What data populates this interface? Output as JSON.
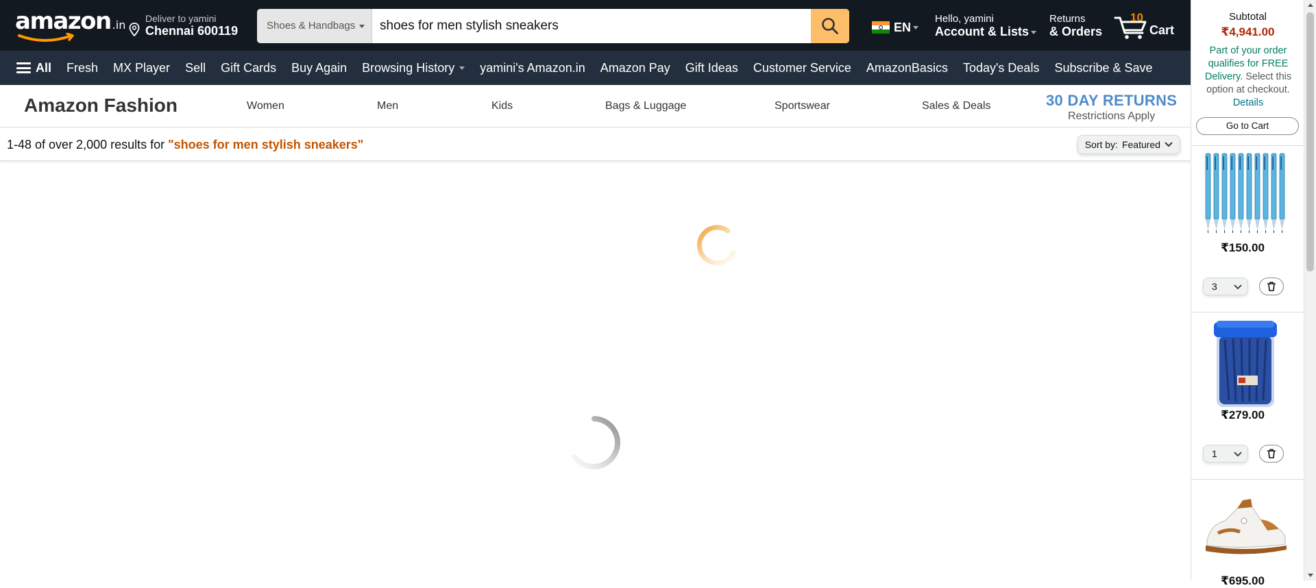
{
  "header": {
    "logo_text": "amazon",
    "logo_tld": ".in",
    "deliver_line1": "Deliver to yamini",
    "deliver_line2": "Chennai 600119",
    "search_category": "Shoes & Handbags",
    "search_value": "shoes for men stylish sneakers",
    "language": "EN",
    "account_line1": "Hello, yamini",
    "account_line2": "Account & Lists",
    "returns_line1": "Returns",
    "returns_line2": "& Orders",
    "cart_count": "10",
    "cart_label": "Cart"
  },
  "nav": {
    "all_label": "All",
    "items": [
      "Fresh",
      "MX Player",
      "Sell",
      "Gift Cards",
      "Buy Again",
      "Browsing History",
      "yamini's Amazon.in",
      "Amazon Pay",
      "Gift Ideas",
      "Customer Service",
      "AmazonBasics",
      "Today's Deals",
      "Subscribe & Save"
    ]
  },
  "fashion": {
    "brand": "Amazon Fashion",
    "categories": [
      "Women",
      "Men",
      "Kids",
      "Bags & Luggage",
      "Sportswear",
      "Sales & Deals"
    ],
    "returns_big": "30 DAY RETURNS",
    "returns_small": "Restrictions Apply"
  },
  "results": {
    "count_text": "1-48 of over 2,000 results for ",
    "query": "\"shoes for men stylish sneakers\"",
    "sort_label": "Sort by:",
    "sort_value": "Featured"
  },
  "cart_panel": {
    "subtotal_label": "Subtotal",
    "subtotal_value": "₹4,941.00",
    "free_delivery": "Part of your order qualifies for FREE Delivery.",
    "free_note": "Select this option at checkout.",
    "details_link": "Details",
    "go_to_cart": "Go to Cart",
    "items": [
      {
        "price": "₹150.00",
        "qty": "3",
        "image": "pens-pack"
      },
      {
        "price": "₹279.00",
        "qty": "1",
        "image": "pen-jar"
      },
      {
        "price": "₹695.00",
        "qty": "",
        "image": "sneaker-shoe"
      }
    ]
  },
  "colors": {
    "nav_dark": "#131921",
    "nav_secondary": "#232f3e",
    "search_button": "#febd69",
    "cart_count": "#f08804",
    "price_red": "#b12704",
    "delivery_green": "#067d62",
    "returns_blue": "#4d8bcb",
    "query_orange": "#c45500"
  }
}
